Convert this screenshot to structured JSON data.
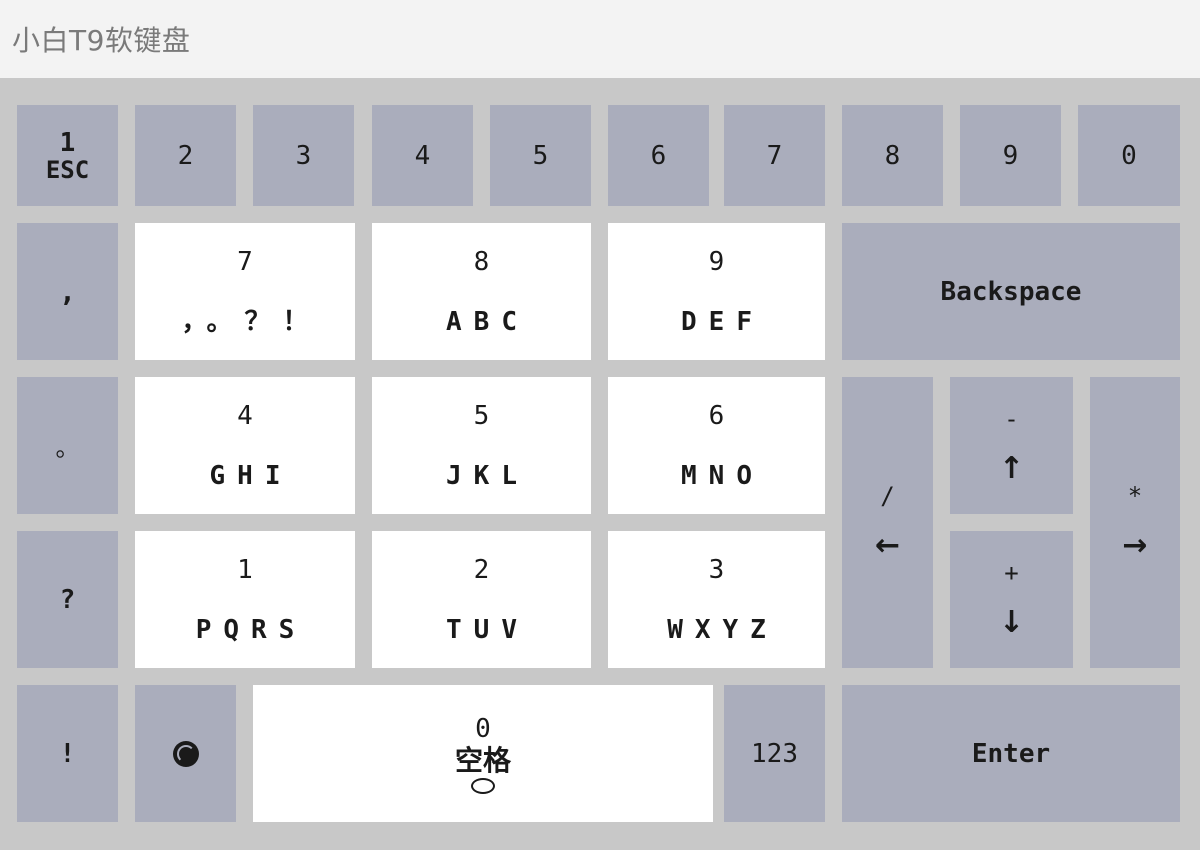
{
  "window": {
    "title": "小白T9软键盘"
  },
  "row1": [
    {
      "id": "key-1-esc",
      "top": "1",
      "bottom": "ESC"
    },
    {
      "id": "key-2",
      "label": "2"
    },
    {
      "id": "key-3",
      "label": "3"
    },
    {
      "id": "key-4",
      "label": "4"
    },
    {
      "id": "key-5",
      "label": "5"
    },
    {
      "id": "key-6",
      "label": "6"
    },
    {
      "id": "key-7",
      "label": "7"
    },
    {
      "id": "key-8",
      "label": "8"
    },
    {
      "id": "key-9",
      "label": "9"
    },
    {
      "id": "key-0",
      "label": "0"
    }
  ],
  "punct": {
    "comma": ",",
    "period": "。",
    "question": "?",
    "exclaim": "!"
  },
  "t9": {
    "k7": {
      "num": "7",
      "letters": "，。？！"
    },
    "k8": {
      "num": "8",
      "letters": "ABC"
    },
    "k9": {
      "num": "9",
      "letters": "DEF"
    },
    "k4": {
      "num": "4",
      "letters": "GHI"
    },
    "k5": {
      "num": "5",
      "letters": "JKL"
    },
    "k6": {
      "num": "6",
      "letters": "MNO"
    },
    "k1": {
      "num": "1",
      "letters": "PQRS"
    },
    "k2": {
      "num": "2",
      "letters": "TUV"
    },
    "k3": {
      "num": "3",
      "letters": "WXYZ"
    }
  },
  "controls": {
    "backspace": "Backspace",
    "enter": "Enter",
    "num_mode": "123",
    "left": {
      "sym": "/",
      "arrow": "←"
    },
    "up": {
      "sym": "-",
      "arrow": "↑"
    },
    "down": {
      "sym": "+",
      "arrow": "↓"
    },
    "right": {
      "sym": "*",
      "arrow": "→"
    },
    "space": {
      "num": "0",
      "label": "空格"
    }
  },
  "icons": {
    "lang": "globe-icon",
    "space": "speech-bubble-icon"
  },
  "colors": {
    "key_gray": "#aaadbc",
    "key_white": "#ffffff",
    "background": "#c8c8c8",
    "titlebar": "#f3f3f3"
  }
}
